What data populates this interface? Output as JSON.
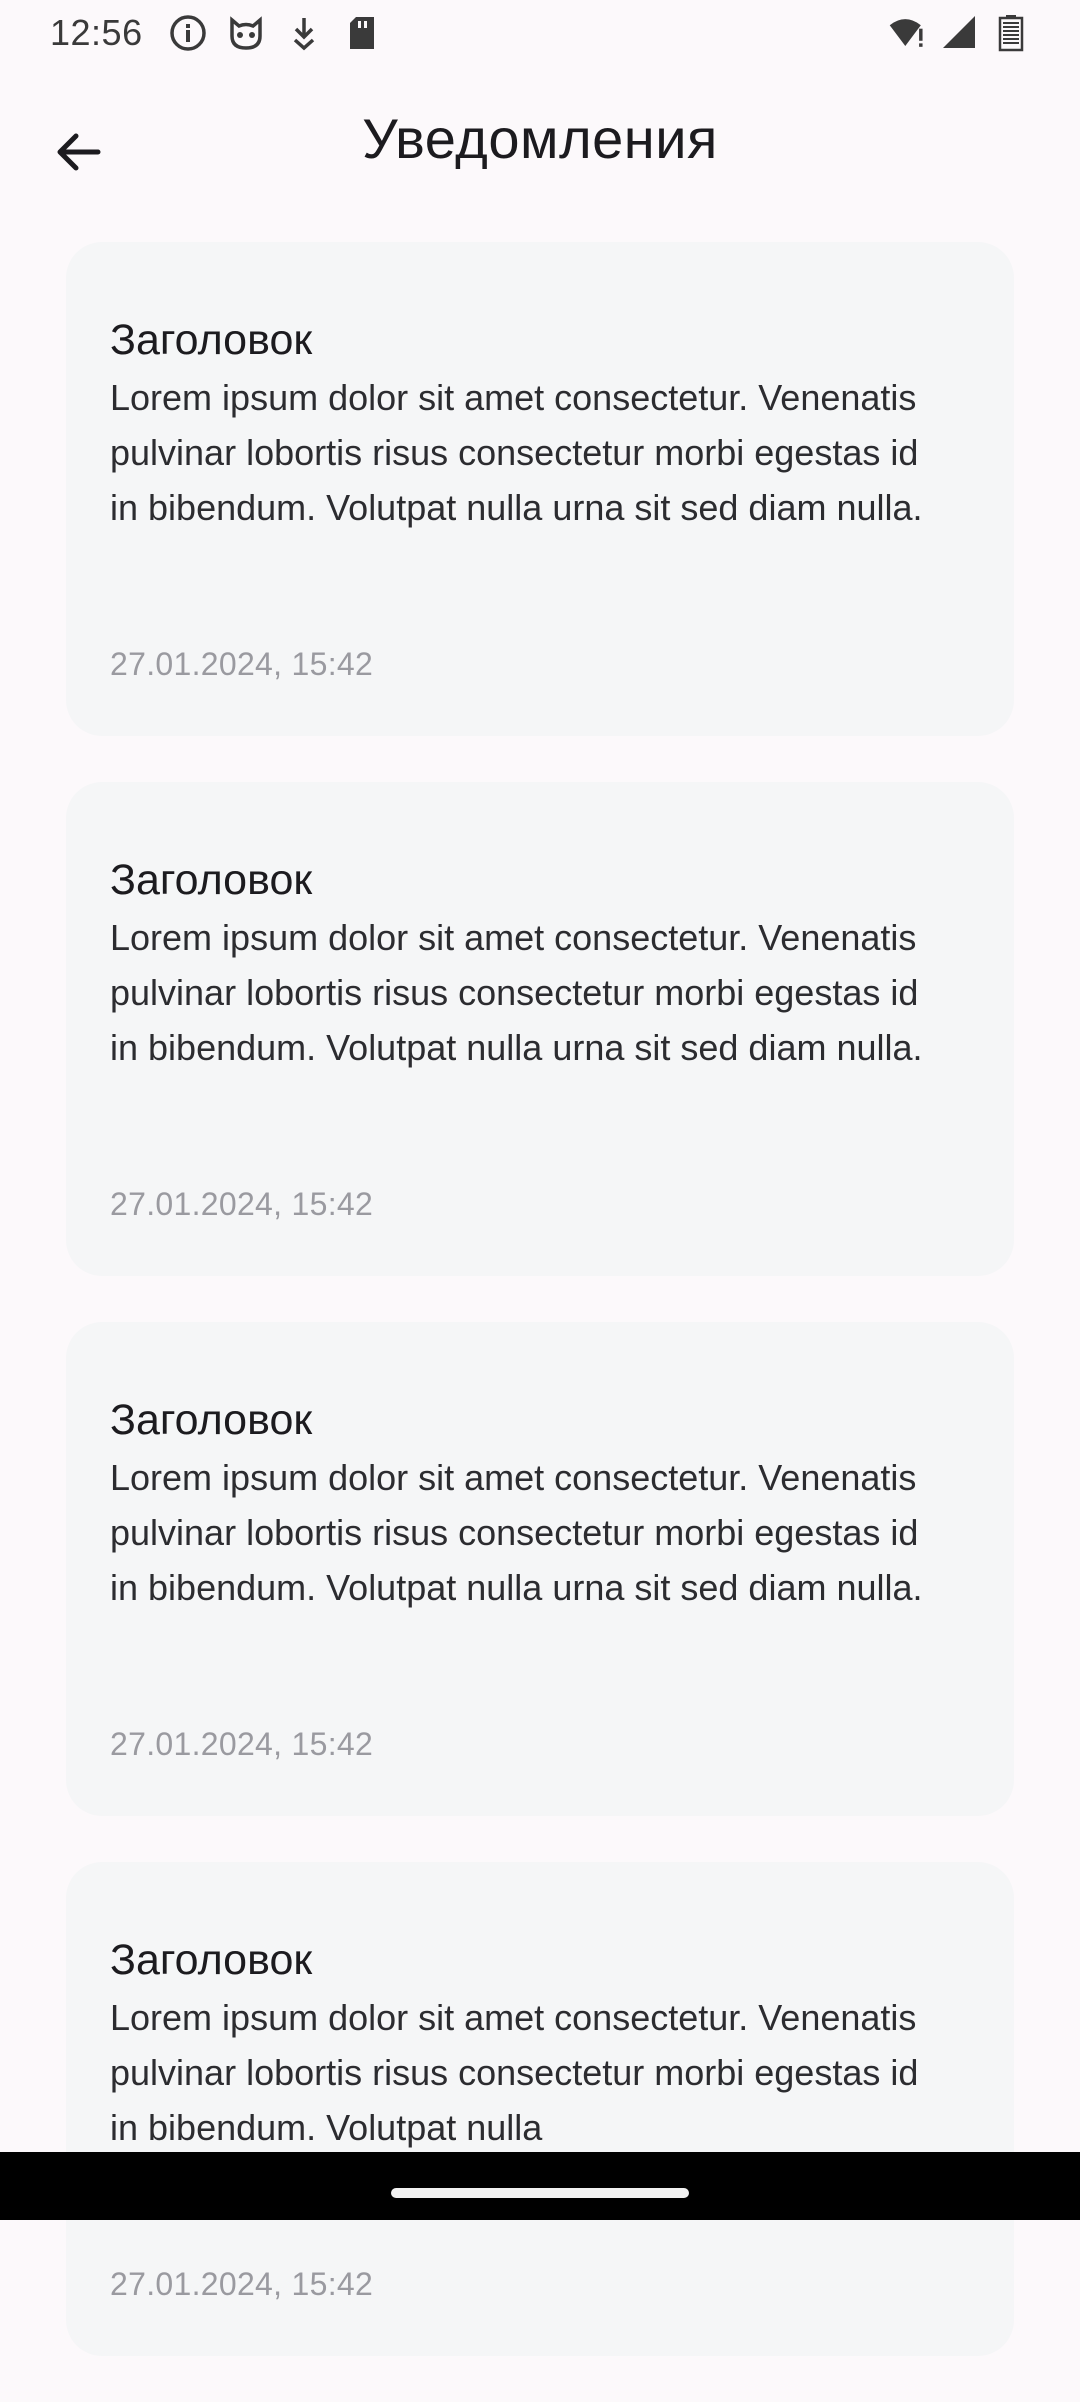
{
  "status_bar": {
    "time": "12:56",
    "left_icons": [
      "info-icon",
      "cat-face-icon",
      "download-icon",
      "sd-card-icon"
    ],
    "right_icons": [
      "wifi-alert-icon",
      "cellular-signal-icon",
      "battery-icon"
    ]
  },
  "header": {
    "back_icon": "arrow-left-icon",
    "title": "Уведомления"
  },
  "notifications": [
    {
      "title": "Заголовок",
      "body": "Lorem ipsum dolor sit amet consectetur. Venenatis pulvinar lobortis risus consectetur morbi egestas id in bibendum. Volutpat nulla urna sit sed diam nulla.",
      "date": "27.01.2024, 15:42"
    },
    {
      "title": "Заголовок",
      "body": "Lorem ipsum dolor sit amet consectetur. Venenatis pulvinar lobortis risus consectetur morbi egestas id in bibendum. Volutpat nulla urna sit sed diam nulla.",
      "date": "27.01.2024, 15:42"
    },
    {
      "title": "Заголовок",
      "body": "Lorem ipsum dolor sit amet consectetur. Venenatis pulvinar lobortis risus consectetur morbi egestas id in bibendum. Volutpat nulla urna sit sed diam nulla.",
      "date": "27.01.2024, 15:42"
    },
    {
      "title": "Заголовок",
      "body": "Lorem ipsum dolor sit amet consectetur. Venenatis pulvinar lobortis risus consectetur morbi egestas id in bibendum. Volutpat nulla",
      "date": "27.01.2024, 15:42"
    }
  ],
  "colors": {
    "background": "#fcf9fb",
    "card": "#f5f6f7",
    "text": "#1c1b1f",
    "date": "#9a9aa0",
    "nav_bar": "#000000"
  }
}
